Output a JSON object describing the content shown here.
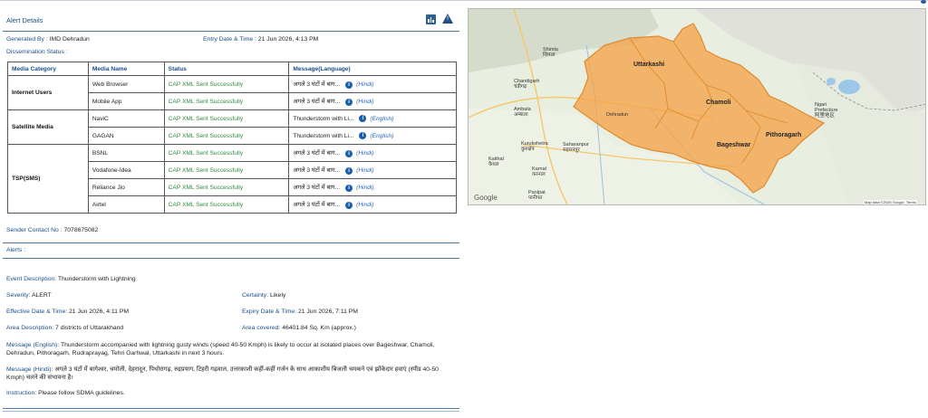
{
  "panel": {
    "title": "Alert Details",
    "icons": {
      "chart": "bar-chart-icon",
      "warning": "warning-triangle-icon"
    }
  },
  "meta": {
    "generated_by_label": "Generated By :",
    "generated_by": "IMD Dehradun",
    "entry_label": "Entry Date & Time :",
    "entry_value": "21 Jun 2026, 4:13 PM",
    "dissemination_label": "Dissemination Status :"
  },
  "table": {
    "headers": [
      "Media Category",
      "Media Name",
      "Status",
      "Message(Language)"
    ],
    "categories": [
      "Internet Users",
      "Satellite Media",
      "TSP(SMS)"
    ],
    "rows": [
      {
        "name": "Web Browser",
        "status": "CAP XML Sent Successfully",
        "message": "अगले 3 घंटों में बाग...",
        "lang": "(Hindi)"
      },
      {
        "name": "Mobile App",
        "status": "CAP XML Sent Successfully",
        "message": "अगले 3 घंटों में बाग...",
        "lang": "(Hindi)"
      },
      {
        "name": "NaviC",
        "status": "CAP XML Sent Successfully",
        "message": "Thunderstorm with Li...",
        "lang": "(English)"
      },
      {
        "name": "GAGAN",
        "status": "CAP XML Sent Successfully",
        "message": "Thunderstorm with Li...",
        "lang": "(English)"
      },
      {
        "name": "BSNL",
        "status": "CAP XML Sent Successfully",
        "message": "अगले 3 घंटों में बाग...",
        "lang": "(Hindi)"
      },
      {
        "name": "Vodafone-Idea",
        "status": "CAP XML Sent Successfully",
        "message": "अगले 3 घंटों में बाग...",
        "lang": "(Hindi)"
      },
      {
        "name": "Reliance Jio",
        "status": "CAP XML Sent Successfully",
        "message": "अगले 3 घंटों में बाग...",
        "lang": "(Hindi)"
      },
      {
        "name": "Airtel",
        "status": "CAP XML Sent Successfully",
        "message": "अगले 3 घंटों में बाग...",
        "lang": "(Hindi)"
      }
    ]
  },
  "contact": {
    "label": "Sender Contact No :",
    "value": "7078675082"
  },
  "alerts": {
    "heading": "Alerts :",
    "event_label": "Event Description:",
    "event_value": "Thunderstorm with Lightning",
    "severity_label": "Severity:",
    "severity_value": "ALERT",
    "certainty_label": "Certainty:",
    "certainty_value": "Likely",
    "effective_label": "Effective Date & Time:",
    "effective_value": "21 Jun 2026, 4:11 PM",
    "expiry_label": "Expiry Date & Time:",
    "expiry_value": "21 Jun 2026, 7:11 PM",
    "area_label": "Area Description:",
    "area_value": "7 districts of Uttarakhand",
    "covered_label": "Area covered:",
    "covered_value": "46401.84 Sq. Km (approx.)",
    "msg_en_label": "Message (English):",
    "msg_en_value": "Thunderstorm accompanied with lightning gusty winds (speed 40-50 Kmph) is likely to occur at isolated places over Bageshwar, Chamoli, Dehradun, Pithoragarh, Rudraprayag, Tehri Garhwal, Uttarkashi in next 3 hours.",
    "msg_hi_label": "Message (Hindi):",
    "msg_hi_value": "अगले 3 घंटों में बागेश्वर, चमोली, देहरादून, पिथोरागढ़, रुद्रप्रयाग, टिहरी गढ़वाल, उत्तरकाशी कहीं-कहीं गर्जन के साथ आकाशीय बिजली चमकने एवं झोंकेदार हवाएं (स्पीड 40-50 Kmph) चलने की संभावना है।",
    "instruction_label": "Instruction:",
    "instruction_value": "Please follow SDMA guidelines."
  },
  "map": {
    "highlight_color": "#f5a34a",
    "places": {
      "uttarkashi": "Uttarkashi",
      "chamoli": "Chamoli",
      "bageshwar": "Bageshwar",
      "pithoragarh": "Pithoragarh",
      "dehradun": "Dehradun",
      "shimla": "Shimla",
      "shimla_hi": "शिमला",
      "chandigarh": "Chandigarh",
      "chandigarh_hi": "चंडीगढ़",
      "ambala": "Ambala",
      "ambala_hi": "अम्बाला",
      "kurukshetra": "Kurukshetra",
      "kurukshetra_hi": "कुरुक्षेत्र",
      "saharanpur": "Saharanpur",
      "saharanpur_hi": "सहारनपुर",
      "kaithal": "Kaithal",
      "kaithal_hi": "कैथल",
      "karnal": "Karnal",
      "karnal_hi": "करनाल",
      "panipat": "Panipat",
      "panipat_hi": "पानीपत",
      "ngari": "Ngari",
      "ngari_sub": "Prefecture",
      "ngari_zh": "阿里地区"
    },
    "google_label": "Google",
    "attribution": "Map data ©2026 Google",
    "terms": "Terms"
  }
}
